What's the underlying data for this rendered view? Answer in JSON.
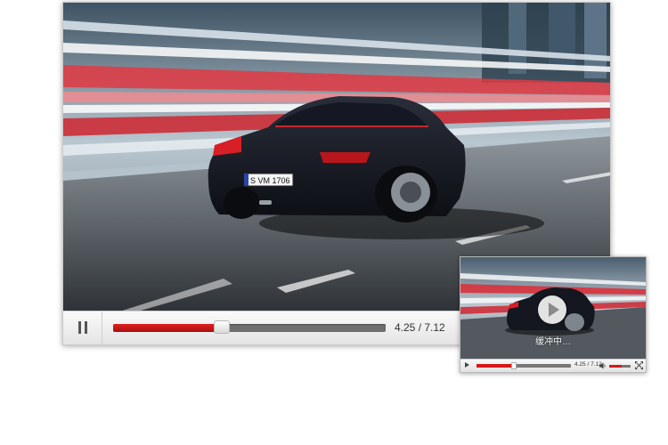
{
  "main_player": {
    "time_display": "4.25 / 7.12",
    "progress": 0.4,
    "pause_icon": "pause-icon",
    "video": {
      "plate_text": "S VM 1706"
    }
  },
  "mini_player": {
    "time_display": "4.25 / 7.12",
    "progress": 0.4,
    "volume": 0.6,
    "status_text": "缓冲中…",
    "play_icon": "play-icon",
    "volume_icon": "speaker-icon",
    "fullscreen_icon": "fullscreen-icon"
  },
  "colors": {
    "progress_red": "#d41818",
    "track_gray": "#6e6e6e",
    "control_bar": "#e8e8e8"
  }
}
